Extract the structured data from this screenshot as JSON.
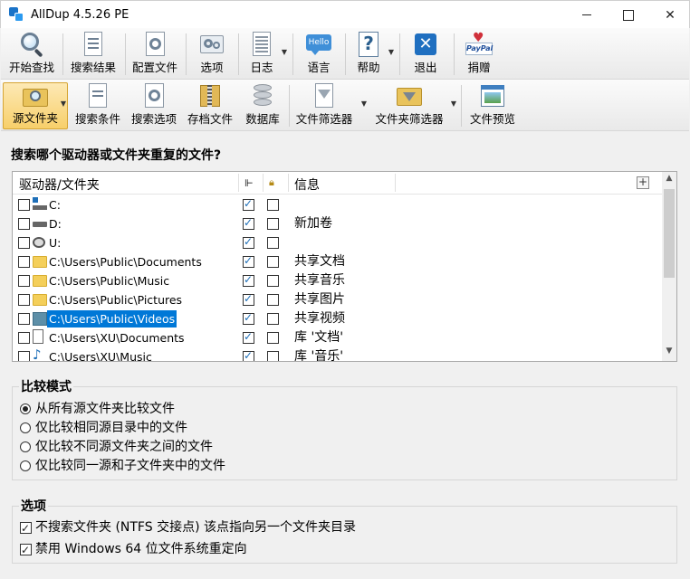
{
  "window": {
    "title": "AllDup 4.5.26 PE",
    "controls": {
      "minimize": "",
      "maximize": "",
      "close": "✕"
    }
  },
  "toolbar1": {
    "start": "开始查找",
    "results": "搜索结果",
    "profile": "配置文件",
    "options": "选项",
    "log": "日志",
    "language": "语言",
    "help": "帮助",
    "exit": "退出",
    "donate": "捐赠",
    "hello_icon_text": "Hello",
    "paypal_icon_text": "PayPal"
  },
  "toolbar2": {
    "source_folder": "源文件夹",
    "search_criteria": "搜索条件",
    "search_options": "搜索选项",
    "archive_files": "存档文件",
    "database": "数据库",
    "file_filter": "文件筛选器",
    "folder_filter": "文件夹筛选器",
    "file_preview": "文件预览"
  },
  "main": {
    "heading": "搜索哪个驱动器或文件夹重复的文件?",
    "columns": {
      "name": "驱动器/文件夹",
      "info": "信息"
    },
    "plus": "+",
    "rows": [
      {
        "name": "C:",
        "info": "",
        "icon": "system-drive-icon",
        "checked": false,
        "sub": true,
        "lock": false
      },
      {
        "name": "D:",
        "info": "新加卷",
        "icon": "drive-icon",
        "checked": false,
        "sub": true,
        "lock": false
      },
      {
        "name": "U:",
        "info": "",
        "icon": "usb-drive-icon",
        "checked": false,
        "sub": true,
        "lock": false
      },
      {
        "name": "C:\\Users\\Public\\Documents",
        "info": "共享文档",
        "icon": "folder-icon",
        "checked": false,
        "sub": true,
        "lock": false
      },
      {
        "name": "C:\\Users\\Public\\Music",
        "info": "共享音乐",
        "icon": "folder-icon",
        "checked": false,
        "sub": true,
        "lock": false
      },
      {
        "name": "C:\\Users\\Public\\Pictures",
        "info": "共享图片",
        "icon": "folder-icon",
        "checked": false,
        "sub": true,
        "lock": false
      },
      {
        "name": "C:\\Users\\Public\\Videos",
        "info": "共享视频",
        "icon": "videos-folder-icon",
        "checked": false,
        "sub": true,
        "lock": false,
        "selected": true
      },
      {
        "name": "C:\\Users\\XU\\Documents",
        "info": "库 '文档'",
        "icon": "documents-library-icon",
        "checked": false,
        "sub": true,
        "lock": false
      },
      {
        "name": "C:\\Users\\XU\\Music",
        "info": "库 '音乐'",
        "icon": "music-library-icon",
        "checked": false,
        "sub": true,
        "lock": false
      }
    ]
  },
  "compare_mode": {
    "title": "比较模式",
    "options": [
      {
        "label": "从所有源文件夹比较文件",
        "selected": true
      },
      {
        "label": "仅比较相同源目录中的文件",
        "selected": false
      },
      {
        "label": "仅比较不同源文件夹之间的文件",
        "selected": false
      },
      {
        "label": "仅比较同一源和子文件夹中的文件",
        "selected": false
      }
    ]
  },
  "options_group": {
    "title": "选项",
    "items": [
      {
        "label": "不搜索文件夹 (NTFS 交接点) 该点指向另一个文件夹目录",
        "checked": true
      },
      {
        "label": "禁用 Windows 64 位文件系统重定向",
        "checked": true
      }
    ]
  },
  "colors": {
    "selection": "#0078d7",
    "accent": "#1e6fb8",
    "active_tool": "#f7cf6a"
  }
}
